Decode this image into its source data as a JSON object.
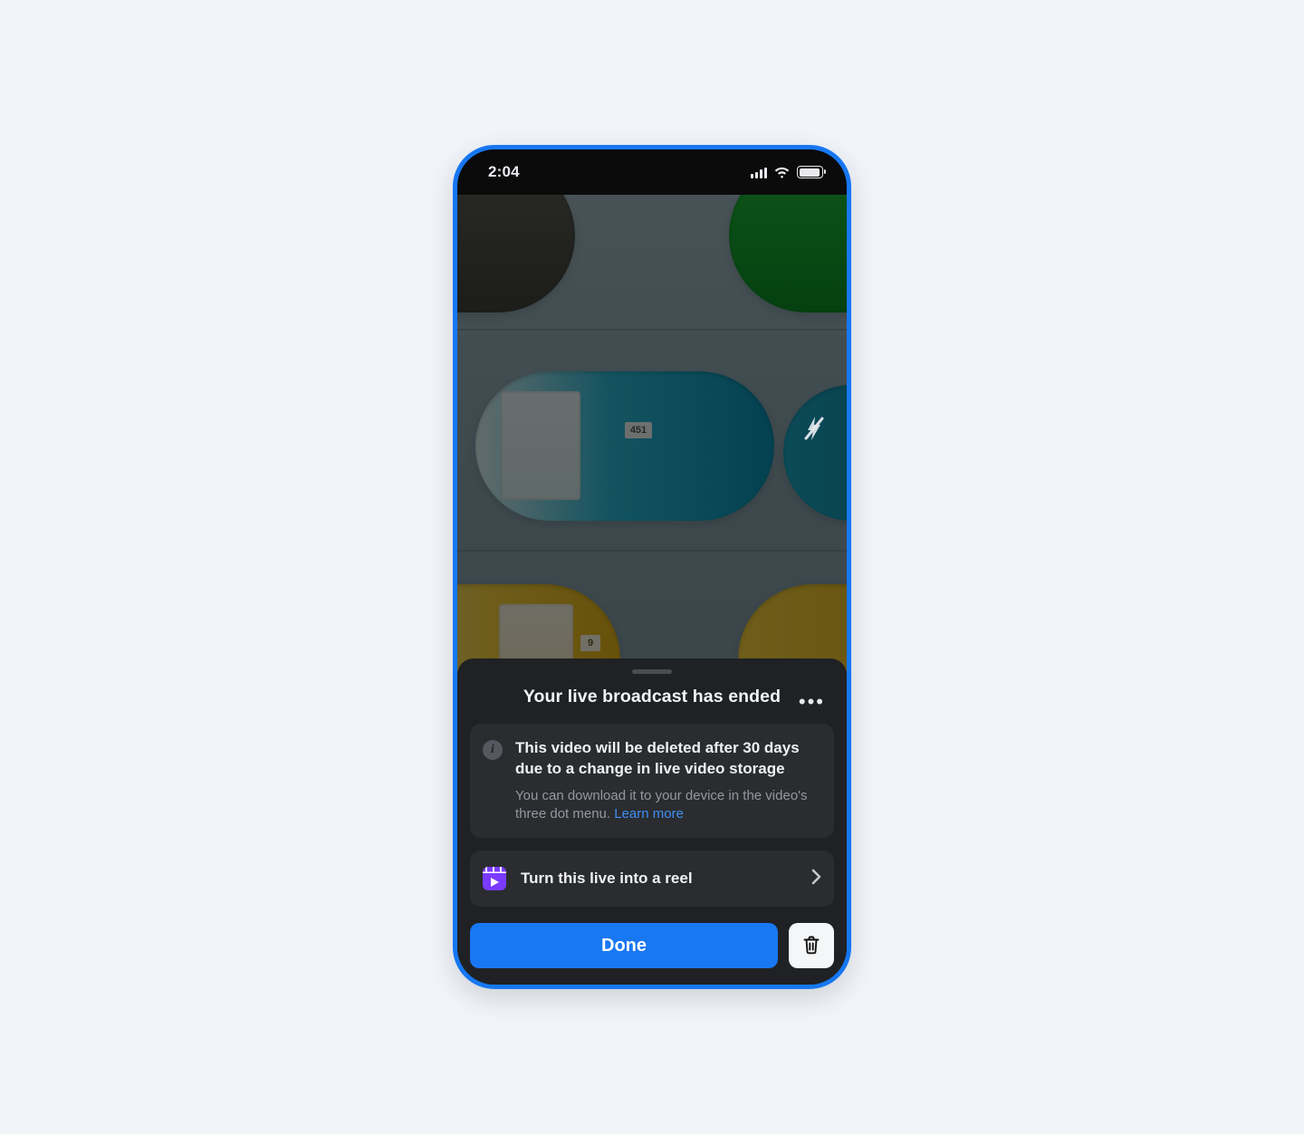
{
  "status": {
    "time": "2:04"
  },
  "photo": {
    "plate_mid": "451",
    "plate_low": "9"
  },
  "sheet": {
    "title": "Your live broadcast has ended",
    "notice_bold": "This video will be deleted after 30 days due to a change in live video storage",
    "notice_sub": "You can download it to your device in the video's three dot menu. ",
    "learn_more": "Learn more",
    "reel_label": "Turn this live into a reel",
    "done_label": "Done"
  }
}
